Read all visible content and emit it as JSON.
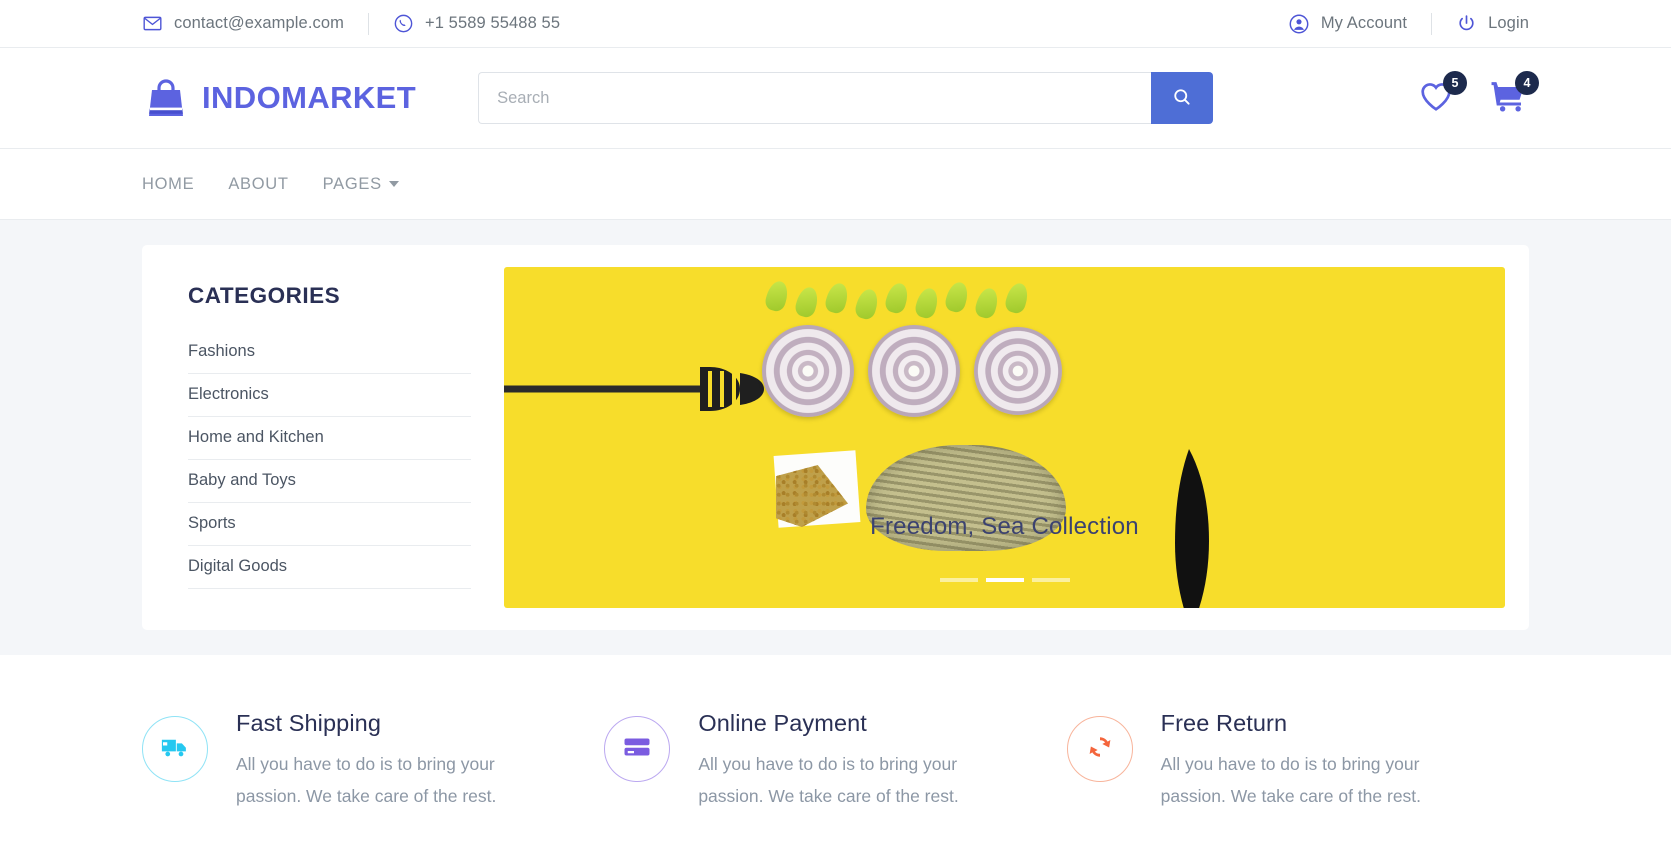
{
  "topbar": {
    "email": "contact@example.com",
    "phone": "+1 5589 55488 55",
    "email_icon": "envelope-icon",
    "phone_icon": "whatsapp-icon",
    "account_label": "My Account",
    "login_label": "Login",
    "account_icon": "user-circle-icon",
    "login_icon": "power-icon"
  },
  "header": {
    "logo_text": "INDOMARKET",
    "logo_icon": "shopping-bag-icon",
    "search_placeholder": "Search",
    "search_value": "",
    "search_icon": "magnifier-icon",
    "wishlist_icon": "heart-icon",
    "wishlist_count": "5",
    "cart_icon": "shopping-cart-icon",
    "cart_count": "4"
  },
  "nav": {
    "items": [
      {
        "label": "HOME",
        "has_dropdown": false
      },
      {
        "label": "ABOUT",
        "has_dropdown": false
      },
      {
        "label": "PAGES",
        "has_dropdown": true
      }
    ]
  },
  "categories": {
    "title": "CATEGORIES",
    "items": [
      {
        "label": "Fashions"
      },
      {
        "label": "Electronics"
      },
      {
        "label": "Home and Kitchen"
      },
      {
        "label": "Baby and Toys"
      },
      {
        "label": "Sports"
      },
      {
        "label": "Digital Goods"
      }
    ]
  },
  "carousel": {
    "caption": "Freedom, Sea Collection",
    "slides": [
      "1",
      "2",
      "3"
    ],
    "active_index": 1,
    "background_color": "#f7dd2b"
  },
  "features": [
    {
      "title": "Fast Shipping",
      "desc": "All you have to do is to bring your passion. We take care of the rest.",
      "icon": "delivery-truck-icon",
      "color": "#25c8f0"
    },
    {
      "title": "Online Payment",
      "desc": "All you have to do is to bring your passion. We take care of the rest.",
      "icon": "credit-card-icon",
      "color": "#7b5ce0"
    },
    {
      "title": "Free Return",
      "desc": "All you have to do is to bring your passion. We take care of the rest.",
      "icon": "refresh-sync-icon",
      "color": "#f4653c"
    }
  ],
  "colors": {
    "brand": "#5c63e0",
    "search_button": "#4e6ed6",
    "badge": "#1d2a4d",
    "page_background": "#f4f6f9"
  }
}
